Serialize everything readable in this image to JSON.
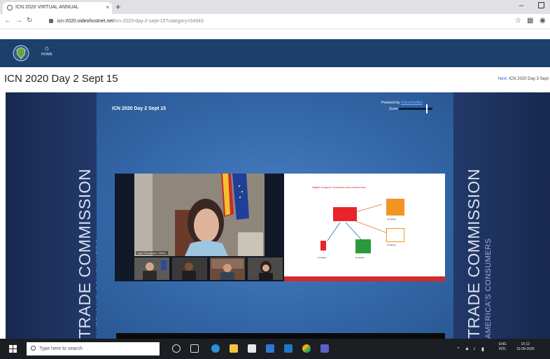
{
  "browser": {
    "tab_title": "ICN 2020 VIRTUAL ANNUAL",
    "tab_close": "×",
    "new_tab": "+",
    "window_minimize": "–",
    "url_host": "icn-2020.videohostnet.net",
    "url_path": "/icn-2020-day-2-sept-15?category=54943",
    "icons": [
      "back-icon",
      "forward-icon",
      "reload-icon",
      "lock-icon",
      "star-icon",
      "extensions-icon",
      "profile-icon"
    ]
  },
  "site": {
    "home_label": "HOME",
    "page_title": "ICN 2020 Day 2 Sept 15",
    "next_label": "Next:",
    "next_title": "ICN 2020 Day 3 Sept"
  },
  "player": {
    "title": "ICN 2020 Day 2 Sept 15",
    "powered_by": "Powered by",
    "powered_brand": "VideoHostNet",
    "zoom_label": "Zoom",
    "zoom_level": 0.82,
    "banner_main": "TRADE COMMISSION",
    "banner_sub": "AMERICA'S CONSUMERS",
    "speaker_label": "Cani Fernández CNMC",
    "slide": {
      "title": "Digital mergers: horizontal and vertical links",
      "captions": [
        "Company",
        "Company",
        "Company",
        "Company"
      ]
    }
  },
  "taskbar": {
    "search_placeholder": "Type here to search",
    "tray_lang": "ENG",
    "tray_region": "INTL",
    "tray_time": "10:12",
    "tray_date": "15-09-2020"
  },
  "colors": {
    "site_header": "#1d3f6b",
    "side_banner": "#1c3260",
    "stage_blue": "#3569ac",
    "slide_red": "#d42a2a",
    "taskbar": "#1b1e23"
  }
}
